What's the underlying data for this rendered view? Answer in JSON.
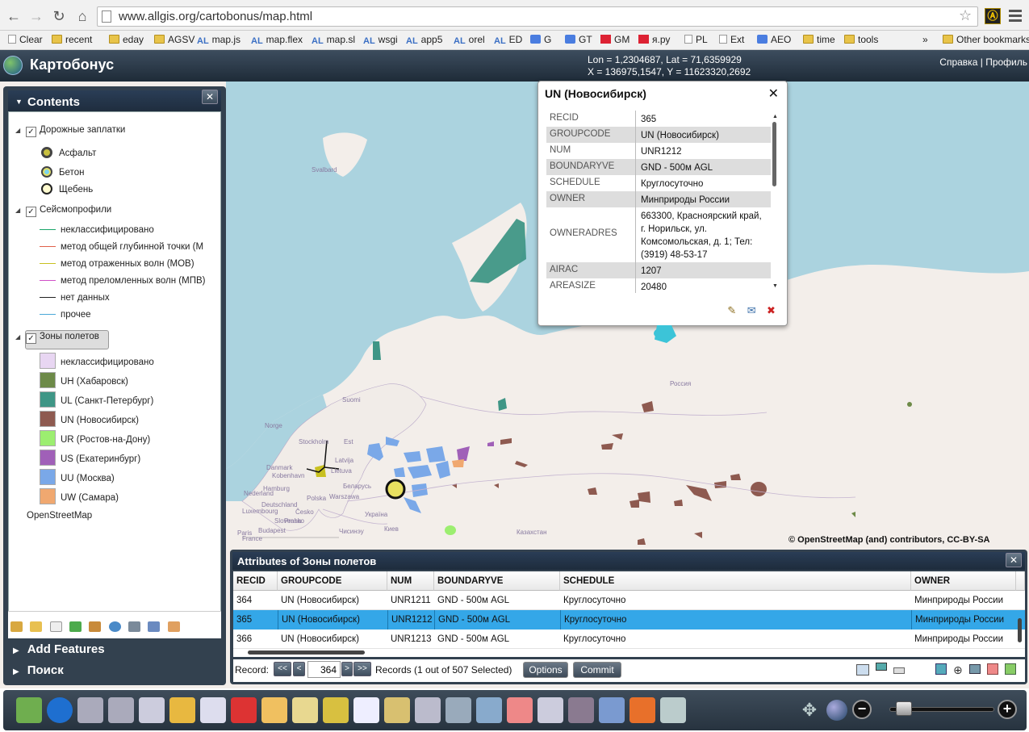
{
  "browser": {
    "url": "www.allgis.org/cartobonus/map.html",
    "bookmarks": [
      "Clear",
      "recent",
      "eday",
      "AGSV",
      "map.js",
      "map.flex",
      "map.sl",
      "wsgi",
      "app5",
      "orel",
      "ED",
      "G",
      "GT",
      "GM",
      "я.ру",
      "PL",
      "Ext",
      "AEO",
      "time",
      "tools",
      "Other bookmarks"
    ],
    "bookmarks_more": "»"
  },
  "header": {
    "title": "Картобонус",
    "coord_line1": "Lon = 1,2304687, Lat = 71,6359929",
    "coord_line2": "X = 136975,1547, Y = 11623320,2692",
    "help_link": "Справка",
    "separator": "|",
    "profile_link": "Профиль"
  },
  "contents": {
    "title": "Contents",
    "close": "✕",
    "layers": [
      {
        "label": "Дорожные заплатки",
        "checked": true
      },
      {
        "label": "Сейсмопрофили",
        "checked": true
      },
      {
        "label": "Зоны полетов",
        "checked": true
      }
    ],
    "road_items": [
      "Асфальт",
      "Бетон",
      "Щебень"
    ],
    "seismic_items": [
      {
        "label": "неклассифицировано",
        "color": "#1aa56a"
      },
      {
        "label": "метод общей глубинной точки (М",
        "color": "#e0604a"
      },
      {
        "label": "метод отраженных волн (МОВ)",
        "color": "#c8c020"
      },
      {
        "label": "метод преломленных волн (МПВ)",
        "color": "#d050c8"
      },
      {
        "label": "нет данных",
        "color": "#222222"
      },
      {
        "label": "прочее",
        "color": "#4aa8d8"
      }
    ],
    "zone_items": [
      {
        "label": "неклассифицировано",
        "color": "#e8d6f2"
      },
      {
        "label": "UH (Хабаровск)",
        "color": "#6d8a48"
      },
      {
        "label": "UL (Санкт-Петербург)",
        "color": "#3f9686"
      },
      {
        "label": "UN (Новосибирск)",
        "color": "#8e5a50"
      },
      {
        "label": "UR (Ростов-на-Дону)",
        "color": "#9cee70"
      },
      {
        "label": "US (Екатеринбург)",
        "color": "#a060b8"
      },
      {
        "label": "UU (Москва)",
        "color": "#7aa8e8"
      },
      {
        "label": "UW (Самара)",
        "color": "#f0a870"
      }
    ],
    "basemap": "OpenStreetMap"
  },
  "side_sections": {
    "add_features": "Add Features",
    "search": "Поиск"
  },
  "map": {
    "labels": [
      "Svalbard",
      "Suomi",
      "Norge",
      "Stockholm",
      "Danmark",
      "Latvija",
      "Lietuva",
      "Беларусь",
      "Україна",
      "Казахстан",
      "Россия",
      "Nederland",
      "Hamburg",
      "Deutschland",
      "Praha",
      "Česko",
      "Luxembourg",
      "Warszawa",
      "Polska",
      "Киев",
      "Чисинэу",
      "Est",
      "Kobenhavn",
      "Budapest",
      "Slovensko",
      "Paris",
      "France"
    ],
    "credit": "© OpenStreetMap (and) contributors, CC-BY-SA"
  },
  "popup": {
    "title": "UN (Новосибирск)",
    "close": "✕",
    "rows": [
      {
        "key": "RECID",
        "value": "365"
      },
      {
        "key": "GROUPCODE",
        "value": "UN (Новосибирск)"
      },
      {
        "key": "NUM",
        "value": "UNR1212"
      },
      {
        "key": "BOUNDARYVE",
        "value": "GND - 500м AGL"
      },
      {
        "key": "SCHEDULE",
        "value": "Круглосуточно"
      },
      {
        "key": "OWNER",
        "value": "Минприроды России"
      },
      {
        "key": "OWNERADRES",
        "value": "663300, Красноярский край, г. Норильск, ул. Комсомольская, д. 1; Тел: (3919) 48-53-17"
      },
      {
        "key": "AIRAC",
        "value": "1207"
      },
      {
        "key": "AREASIZE",
        "value": "20480"
      }
    ],
    "actions": [
      "edit-icon",
      "comment-icon",
      "delete-icon"
    ]
  },
  "attributes": {
    "title": "Attributes of Зоны полетов",
    "close": "✕",
    "columns": [
      "RECID",
      "GROUPCODE",
      "NUM",
      "BOUNDARYVE",
      "SCHEDULE",
      "OWNER"
    ],
    "rows": [
      [
        "364",
        "UN (Новосибирск)",
        "UNR1211",
        "GND - 500м AGL",
        "Круглосуточно",
        "Минприроды России"
      ],
      [
        "365",
        "UN (Новосибирск)",
        "UNR1212",
        "GND - 500м AGL",
        "Круглосуточно",
        "Минприроды России"
      ],
      [
        "366",
        "UN (Новосибирск)",
        "UNR1213",
        "GND - 500м AGL",
        "Круглосуточно",
        "Минприроды России"
      ]
    ],
    "selected_row": 1,
    "record_label": "Record:",
    "first": "<<",
    "prev": "<",
    "record_value": "364",
    "next": ">",
    "last": ">>",
    "status": "Records (1 out of 507 Selected)",
    "options_button": "Options",
    "commit_button": "Commit"
  },
  "bottom_toolbar": {
    "tools": [
      "map-icon",
      "info-icon",
      "measure-icon",
      "measure-area-icon",
      "print-preview-icon",
      "open-folder-icon",
      "print-icon",
      "pdf-icon",
      "add-data-icon",
      "grid-icon",
      "basemap-icon",
      "document-icon",
      "edit-map-icon",
      "binoculars-icon",
      "select-icon",
      "select-edit-icon",
      "eraser-icon",
      "zoom-to-icon",
      "layer-tool-icon",
      "bookmark-icon",
      "rss-icon",
      "database-icon"
    ],
    "zoom_out": "−",
    "zoom_in": "+",
    "zoom_level": 0.05
  }
}
